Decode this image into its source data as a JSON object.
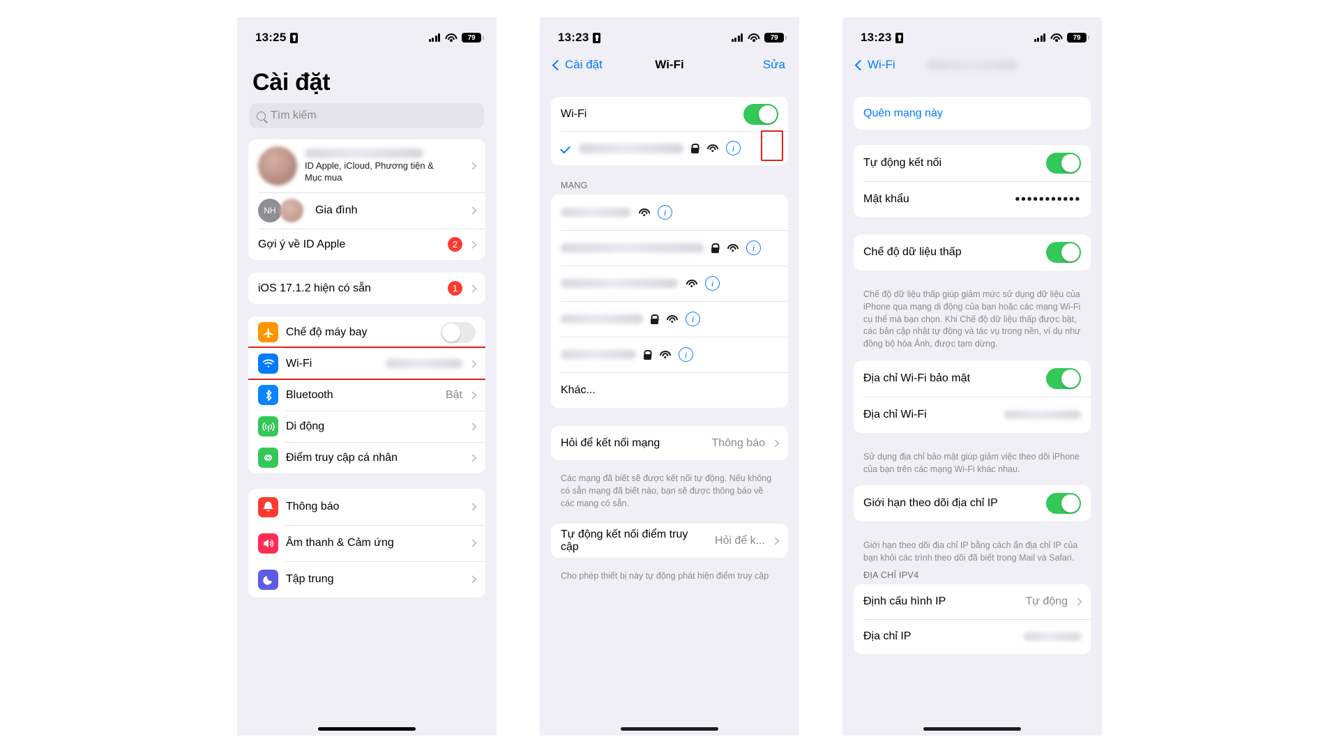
{
  "panels": {
    "settings": {
      "status": {
        "time": "13:25",
        "battery": "79"
      },
      "title": "Cài đặt",
      "search_placeholder": "Tìm kiếm",
      "account": {
        "subtitle_line1": "ID Apple, iCloud, Phương tiện &",
        "subtitle_line2": "Mục mua",
        "family_label": "Gia đình",
        "family_initials": "NH"
      },
      "suggestion": {
        "label": "Gợi ý về ID Apple",
        "badge": "2"
      },
      "update": {
        "label": "iOS 17.1.2 hiện có sẵn",
        "badge": "1"
      },
      "connectivity": [
        {
          "label": "Chế độ máy bay",
          "icon": "airplane-icon",
          "color": "#ff9500",
          "type": "toggle",
          "on": false
        },
        {
          "label": "Wi-Fi",
          "icon": "wifi-icon",
          "color": "#007aff",
          "type": "value-blurred",
          "highlight": true
        },
        {
          "label": "Bluetooth",
          "icon": "bluetooth-icon",
          "color": "#0a84ff",
          "type": "value",
          "value": "Bật"
        },
        {
          "label": "Di động",
          "icon": "cellular-icon",
          "color": "#34c759",
          "type": "chevron"
        },
        {
          "label": "Điểm truy cập cá nhân",
          "icon": "hotspot-icon",
          "color": "#34c759",
          "type": "chevron"
        }
      ],
      "system": [
        {
          "label": "Thông báo",
          "icon": "notifications-icon",
          "color": "#ff3b30"
        },
        {
          "label": "Âm thanh & Cảm ứng",
          "icon": "sounds-icon",
          "color": "#ff2d55"
        },
        {
          "label": "Tập trung",
          "icon": "focus-icon",
          "color": "#5e5ce6"
        }
      ]
    },
    "wifi": {
      "status": {
        "time": "13:23",
        "battery": "79"
      },
      "nav": {
        "back": "Cài đặt",
        "title": "Wi-Fi",
        "right": "Sửa"
      },
      "wifi_toggle_label": "Wi-Fi",
      "wifi_on": true,
      "networks_header": "MẠNG",
      "networks": [
        {
          "secured": false
        },
        {
          "secured": true
        },
        {
          "secured": false
        },
        {
          "secured": true
        },
        {
          "secured": true
        }
      ],
      "other_label": "Khác...",
      "ask_join": {
        "label": "Hỏi để kết nối mạng",
        "value": "Thông báo"
      },
      "ask_join_note": "Các mạng đã biết sẽ được kết nối tự động. Nếu không có sẵn mạng đã biết nào, bạn sẽ được thông báo về các mạng có sẵn.",
      "auto_hotspot": {
        "label": "Tự động kết nối điểm truy cập",
        "value": "Hỏi để k..."
      },
      "auto_hotspot_note": "Cho phép thiết bị này tự động phát hiện điểm truy cập"
    },
    "network_detail": {
      "status": {
        "time": "13:23",
        "battery": "79"
      },
      "nav": {
        "back": "Wi-Fi"
      },
      "forget_label": "Quên mạng này",
      "auto_join": {
        "label": "Tự động kết nối",
        "on": true
      },
      "password": {
        "label": "Mật khẩu",
        "value": "•••••••••••"
      },
      "low_data": {
        "label": "Chế độ dữ liệu thấp",
        "on": true,
        "highlight": true
      },
      "low_data_note": "Chế độ dữ liệu thấp giúp giảm mức sử dụng dữ liệu của iPhone qua mạng di động của bạn hoặc các mạng Wi-Fi cụ thể mà bạn chọn. Khi Chế độ dữ liệu thấp được bật, các bản cập nhật tự động và tác vụ trong nền, ví dụ như đồng bộ hóa Ảnh, được tạm dừng.",
      "private_addr": {
        "label": "Địa chỉ Wi-Fi bảo mật",
        "on": true
      },
      "wifi_addr_label": "Địa chỉ Wi-Fi",
      "private_note": "Sử dụng địa chỉ bảo mật giúp giảm việc theo dõi iPhone của bạn trên các mạng Wi-Fi khác nhau.",
      "limit_tracking": {
        "label": "Giới hạn theo dõi địa chỉ IP",
        "on": true
      },
      "limit_note": "Giới hạn theo dõi địa chỉ IP bằng cách ẩn địa chỉ IP của bạn khỏi các trình theo dõi đã biết trong Mail và Safari.",
      "ipv4_header": "ĐỊA CHỈ IPV4",
      "configure_ip": {
        "label": "Định cấu hình IP",
        "value": "Tự động"
      },
      "ip_label": "Địa chỉ IP"
    }
  },
  "colors": {
    "accent": "#007aff",
    "green": "#34c759",
    "red_badge": "#ff3b30",
    "highlight_box": "#e0221a",
    "page_bg": "#f0eff5"
  }
}
